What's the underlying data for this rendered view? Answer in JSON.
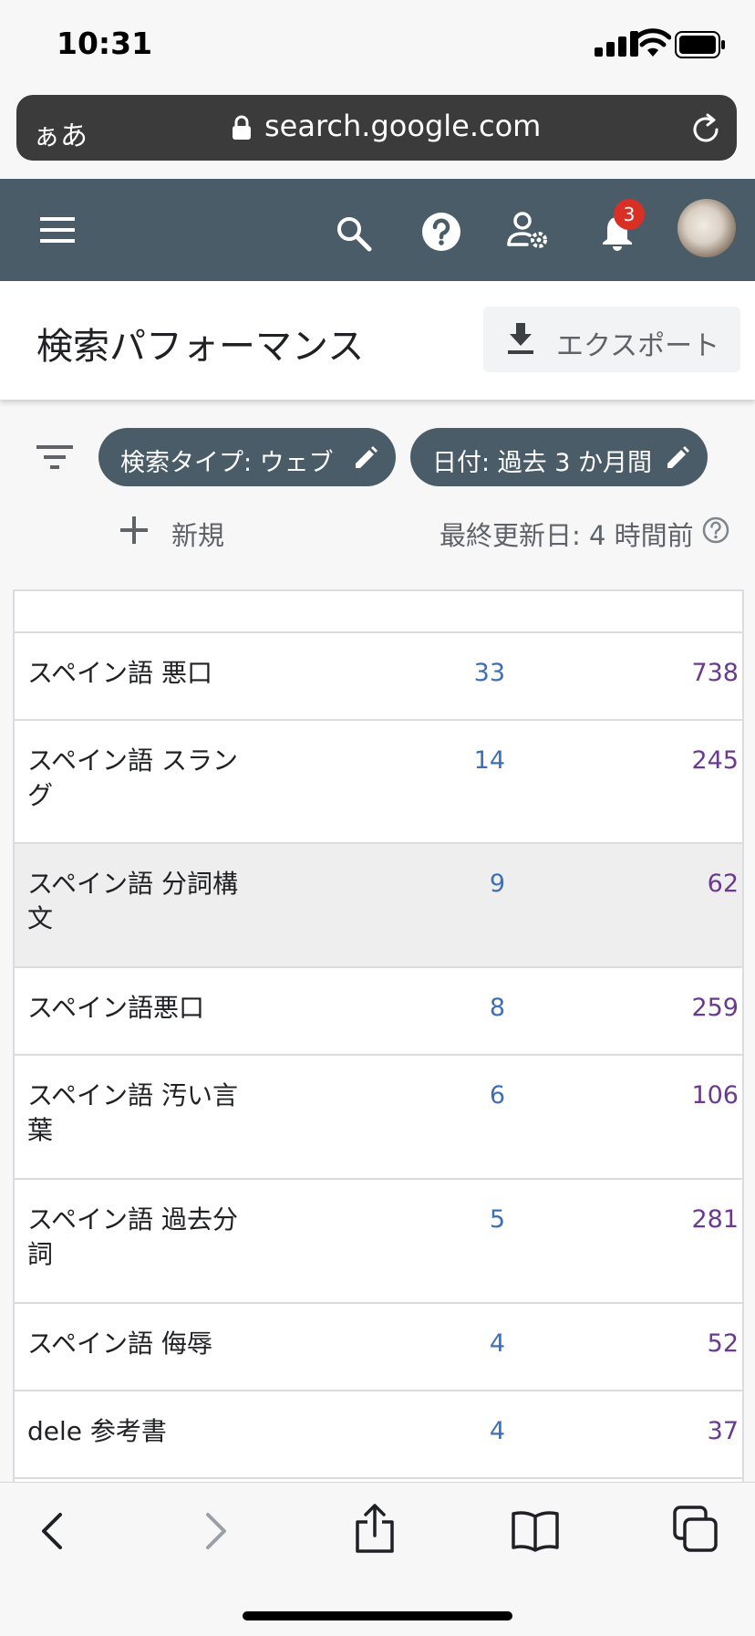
{
  "status": {
    "time": "10:31"
  },
  "browser": {
    "aa_label": "ぁあ",
    "url": "search.google.com"
  },
  "app": {
    "notification_count": "3"
  },
  "page": {
    "title": "検索パフォーマンス",
    "export_label": "エクスポート"
  },
  "filters": {
    "chips": [
      {
        "label": "検索タイプ: ウェブ"
      },
      {
        "label": "日付: 過去 3 か月間"
      }
    ],
    "new_label": "新規",
    "last_updated": "最終更新日: 4 時間前"
  },
  "table": {
    "rows": [
      {
        "query": "",
        "clicks": "",
        "impressions": ""
      },
      {
        "query": "スペイン語 悪口",
        "clicks": "33",
        "impressions": "738"
      },
      {
        "query": "スペイン語 スラング",
        "clicks": "14",
        "impressions": "245"
      },
      {
        "query": "スペイン語 分詞構文",
        "clicks": "9",
        "impressions": "62"
      },
      {
        "query": "スペイン語悪口",
        "clicks": "8",
        "impressions": "259"
      },
      {
        "query": "スペイン語 汚い言葉",
        "clicks": "6",
        "impressions": "106"
      },
      {
        "query": "スペイン語 過去分詞",
        "clicks": "5",
        "impressions": "281"
      },
      {
        "query": "スペイン語 侮辱",
        "clicks": "4",
        "impressions": "52"
      },
      {
        "query": "dele 参考書",
        "clicks": "4",
        "impressions": "37"
      }
    ]
  },
  "colors": {
    "app_bar": "#4a5c68",
    "clicks": "#3d6fb4",
    "impressions": "#6b3a8f",
    "badge": "#d93025"
  }
}
